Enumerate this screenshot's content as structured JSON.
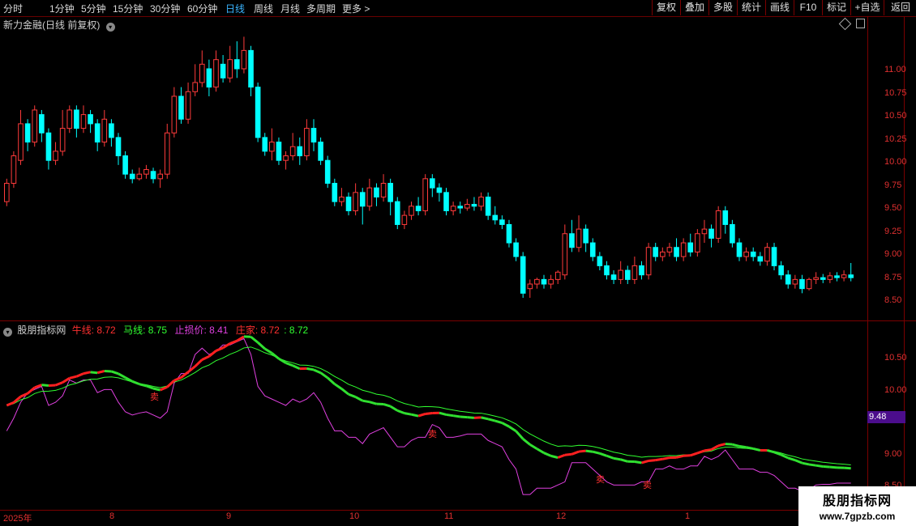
{
  "toolbar": {
    "timeframes": [
      "分时",
      "1分钟",
      "5分钟",
      "15分钟",
      "30分钟",
      "60分钟",
      "日线",
      "周线",
      "月线",
      "多周期",
      "更多 >"
    ],
    "active": "日线",
    "buttons": [
      "复权",
      "叠加",
      "多股",
      "统计",
      "画线",
      "F10",
      "标记",
      "+自选",
      "返回"
    ]
  },
  "main_panel": {
    "title": "新力金融(日线 前复权)",
    "y_ticks": [
      "11.00",
      "10.75",
      "10.50",
      "10.25",
      "10.00",
      "9.75",
      "9.50",
      "9.25",
      "9.00",
      "8.75",
      "8.50"
    ]
  },
  "indicator_panel": {
    "name": "股朋指标网",
    "items": [
      {
        "label": "牛线: 8.72",
        "color": "#ff3030"
      },
      {
        "label": "马线: 8.75",
        "color": "#30ff30"
      },
      {
        "label": "止损价: 8.41",
        "color": "#e040e0"
      },
      {
        "label": "庄家: 8.72",
        "color": "#ff3030"
      },
      {
        "label": ": 8.72",
        "color": "#30ff30"
      }
    ],
    "y_ticks": [
      "10.50",
      "10.00",
      "9.00",
      "8.50"
    ],
    "current_value": "9.48",
    "sell_marker": "卖",
    "markers": [
      "卖",
      "卖",
      "卖",
      "卖"
    ]
  },
  "x_axis": {
    "labels": [
      "2025年",
      "8",
      "9",
      "10",
      "11",
      "12",
      "1"
    ]
  },
  "watermark": {
    "line1": "股朋指标网",
    "line2": "www.7gpzb.com"
  },
  "colors": {
    "up": "#ff3b3b",
    "down": "#00ffff",
    "grid": "#7a0000",
    "active": "#3ab4ff"
  },
  "chart_data": {
    "type": "candlestick",
    "ylim": [
      8.4,
      11.3
    ],
    "candles": [
      [
        9.55,
        9.75,
        9.5,
        9.8
      ],
      [
        9.75,
        10.05,
        9.7,
        10.1
      ],
      [
        10.0,
        10.4,
        9.95,
        10.55
      ],
      [
        10.4,
        10.2,
        10.1,
        10.45
      ],
      [
        10.2,
        10.55,
        10.15,
        10.6
      ],
      [
        10.5,
        10.3,
        10.2,
        10.55
      ],
      [
        10.3,
        10.0,
        9.9,
        10.35
      ],
      [
        10.0,
        10.1,
        9.95,
        10.2
      ],
      [
        10.1,
        10.35,
        10.05,
        10.55
      ],
      [
        10.35,
        10.55,
        10.3,
        10.6
      ],
      [
        10.55,
        10.35,
        10.25,
        10.6
      ],
      [
        10.35,
        10.5,
        10.3,
        10.6
      ],
      [
        10.5,
        10.4,
        10.3,
        10.55
      ],
      [
        10.4,
        10.2,
        10.1,
        10.45
      ],
      [
        10.2,
        10.45,
        10.15,
        10.55
      ],
      [
        10.4,
        10.25,
        10.15,
        10.45
      ],
      [
        10.25,
        10.05,
        9.95,
        10.3
      ],
      [
        10.05,
        9.85,
        9.8,
        10.1
      ],
      [
        9.85,
        9.8,
        9.75,
        9.9
      ],
      [
        9.8,
        9.85,
        9.78,
        9.92
      ],
      [
        9.85,
        9.9,
        9.8,
        9.95
      ],
      [
        9.88,
        9.8,
        9.75,
        9.92
      ],
      [
        9.8,
        9.85,
        9.7,
        9.9
      ],
      [
        9.85,
        10.3,
        9.8,
        10.4
      ],
      [
        10.3,
        10.7,
        10.25,
        10.8
      ],
      [
        10.7,
        10.45,
        10.4,
        10.8
      ],
      [
        10.45,
        10.75,
        10.4,
        10.85
      ],
      [
        10.75,
        10.85,
        10.7,
        11.05
      ],
      [
        10.85,
        11.05,
        10.8,
        11.2
      ],
      [
        11.0,
        10.8,
        10.7,
        11.1
      ],
      [
        10.8,
        11.1,
        10.75,
        11.2
      ],
      [
        11.05,
        10.9,
        10.85,
        11.15
      ],
      [
        10.9,
        11.1,
        10.85,
        11.25
      ],
      [
        11.1,
        11.0,
        10.9,
        11.3
      ],
      [
        11.0,
        11.2,
        10.95,
        11.35
      ],
      [
        11.2,
        10.8,
        10.7,
        11.25
      ],
      [
        10.8,
        10.25,
        10.2,
        10.85
      ],
      [
        10.25,
        10.1,
        10.05,
        10.3
      ],
      [
        10.1,
        10.2,
        10.0,
        10.35
      ],
      [
        10.2,
        10.0,
        9.95,
        10.25
      ],
      [
        10.0,
        10.05,
        9.9,
        10.1
      ],
      [
        10.05,
        10.15,
        10.0,
        10.3
      ],
      [
        10.15,
        10.05,
        9.95,
        10.25
      ],
      [
        10.05,
        10.35,
        10.0,
        10.45
      ],
      [
        10.35,
        10.2,
        10.1,
        10.45
      ],
      [
        10.2,
        10.0,
        9.95,
        10.25
      ],
      [
        10.0,
        9.75,
        9.7,
        10.05
      ],
      [
        9.75,
        9.55,
        9.5,
        9.8
      ],
      [
        9.55,
        9.6,
        9.5,
        9.7
      ],
      [
        9.6,
        9.45,
        9.4,
        9.65
      ],
      [
        9.45,
        9.65,
        9.4,
        9.75
      ],
      [
        9.65,
        9.5,
        9.3,
        9.7
      ],
      [
        9.5,
        9.7,
        9.45,
        9.8
      ],
      [
        9.7,
        9.6,
        9.5,
        9.75
      ],
      [
        9.6,
        9.75,
        9.55,
        9.85
      ],
      [
        9.75,
        9.55,
        9.4,
        9.8
      ],
      [
        9.55,
        9.3,
        9.25,
        9.6
      ],
      [
        9.3,
        9.4,
        9.25,
        9.45
      ],
      [
        9.4,
        9.5,
        9.35,
        9.55
      ],
      [
        9.5,
        9.45,
        9.4,
        9.6
      ],
      [
        9.45,
        9.8,
        9.4,
        9.85
      ],
      [
        9.8,
        9.7,
        9.6,
        9.85
      ],
      [
        9.7,
        9.65,
        9.55,
        9.75
      ],
      [
        9.65,
        9.45,
        9.4,
        9.7
      ],
      [
        9.45,
        9.5,
        9.4,
        9.55
      ],
      [
        9.5,
        9.48,
        9.42,
        9.55
      ],
      [
        9.48,
        9.52,
        9.45,
        9.58
      ],
      [
        9.52,
        9.5,
        9.45,
        9.6
      ],
      [
        9.5,
        9.6,
        9.45,
        9.65
      ],
      [
        9.6,
        9.4,
        9.35,
        9.65
      ],
      [
        9.4,
        9.35,
        9.3,
        9.5
      ],
      [
        9.35,
        9.3,
        9.25,
        9.4
      ],
      [
        9.3,
        9.1,
        9.05,
        9.35
      ],
      [
        9.1,
        8.95,
        8.9,
        9.15
      ],
      [
        8.95,
        8.55,
        8.5,
        9.0
      ],
      [
        8.6,
        8.65,
        8.5,
        8.7
      ],
      [
        8.65,
        8.7,
        8.6,
        8.72
      ],
      [
        8.7,
        8.65,
        8.6,
        8.75
      ],
      [
        8.65,
        8.7,
        8.6,
        8.75
      ],
      [
        8.7,
        8.78,
        8.65,
        8.8
      ],
      [
        8.75,
        9.2,
        8.7,
        9.3
      ],
      [
        9.2,
        9.05,
        9.0,
        9.35
      ],
      [
        9.05,
        9.25,
        9.0,
        9.4
      ],
      [
        9.25,
        9.1,
        9.0,
        9.3
      ],
      [
        9.1,
        8.95,
        8.9,
        9.15
      ],
      [
        8.95,
        8.85,
        8.8,
        9.0
      ],
      [
        8.85,
        8.75,
        8.7,
        8.9
      ],
      [
        8.75,
        8.7,
        8.65,
        8.8
      ],
      [
        8.7,
        8.8,
        8.65,
        8.9
      ],
      [
        8.8,
        8.7,
        8.65,
        8.85
      ],
      [
        8.7,
        8.85,
        8.65,
        8.95
      ],
      [
        8.85,
        8.75,
        8.7,
        8.9
      ],
      [
        8.75,
        9.05,
        8.7,
        9.1
      ],
      [
        9.05,
        8.95,
        8.9,
        9.1
      ],
      [
        8.95,
        9.0,
        8.9,
        9.05
      ],
      [
        9.0,
        9.05,
        8.95,
        9.1
      ],
      [
        9.05,
        8.95,
        8.9,
        9.15
      ],
      [
        8.95,
        9.1,
        8.9,
        9.15
      ],
      [
        9.1,
        9.0,
        8.95,
        9.2
      ],
      [
        9.0,
        9.2,
        8.95,
        9.25
      ],
      [
        9.2,
        9.25,
        9.1,
        9.35
      ],
      [
        9.25,
        9.15,
        9.05,
        9.3
      ],
      [
        9.15,
        9.45,
        9.1,
        9.5
      ],
      [
        9.45,
        9.3,
        9.2,
        9.5
      ],
      [
        9.3,
        9.1,
        9.05,
        9.35
      ],
      [
        9.1,
        8.95,
        8.9,
        9.15
      ],
      [
        8.95,
        9.0,
        8.9,
        9.05
      ],
      [
        9.0,
        8.95,
        8.9,
        9.05
      ],
      [
        8.95,
        8.9,
        8.85,
        9.0
      ],
      [
        8.9,
        9.05,
        8.85,
        9.1
      ],
      [
        9.05,
        8.85,
        8.8,
        9.1
      ],
      [
        8.85,
        8.75,
        8.7,
        8.9
      ],
      [
        8.75,
        8.65,
        8.6,
        8.8
      ],
      [
        8.65,
        8.7,
        8.6,
        8.75
      ],
      [
        8.7,
        8.6,
        8.55,
        8.75
      ],
      [
        8.6,
        8.7,
        8.58,
        8.72
      ],
      [
        8.7,
        8.72,
        8.65,
        8.78
      ],
      [
        8.72,
        8.7,
        8.66,
        8.76
      ],
      [
        8.7,
        8.74,
        8.66,
        8.78
      ],
      [
        8.74,
        8.72,
        8.68,
        8.78
      ],
      [
        8.72,
        8.75,
        8.68,
        8.8
      ],
      [
        8.75,
        8.72,
        8.68,
        8.88
      ]
    ]
  }
}
